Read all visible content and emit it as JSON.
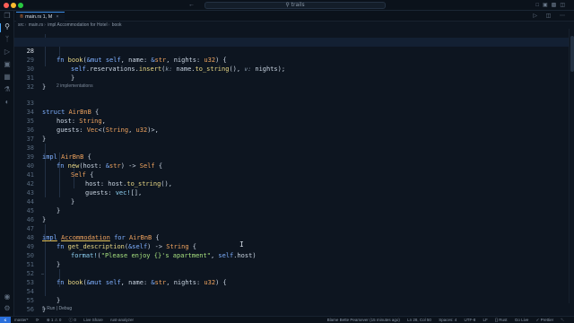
{
  "window": {
    "title": "trails",
    "nav_arrows": "← →"
  },
  "tab": {
    "icon": "®",
    "label": "main.rs 1, M",
    "close": "×"
  },
  "breadcrumb": [
    "src",
    "main.rs",
    "impl Accommodation for Hotel",
    "book"
  ],
  "codelens": {
    "implementations": "2 implementations"
  },
  "run_lens": "▷ Run | Debug",
  "status": {
    "remote": "≤",
    "branch": "master*",
    "sync": "⟳",
    "problems": "⊗ 1 ⚠ 0",
    "warnings": "ⓘ 0",
    "live_share": "Live Share",
    "analyzer": "rust-analyzer",
    "blame": "Blame Bette Pearsever (15 minutes ago)",
    "position": "Ln 28, Col 50",
    "spaces": "Spaces: 4",
    "encoding": "UTF-8",
    "eol": "LF",
    "language": "{} Rust",
    "golive": "Go Live",
    "prettier": "✓ Prettier",
    "bell": "␇"
  },
  "lines": [
    {
      "n": "27",
      "text": ""
    },
    {
      "n": "28",
      "text": "fn book(&mut self, name: &str, nights: u32) {"
    },
    {
      "n": "29",
      "text": "self.reservations.insert(k: name.to_string(), v: nights);"
    },
    {
      "n": "30",
      "text": "}"
    },
    {
      "n": "31",
      "text": "}"
    },
    {
      "n": "32",
      "text": ""
    },
    {
      "n": "33",
      "text": "struct AirBnB {"
    },
    {
      "n": "34",
      "text": "host: String,"
    },
    {
      "n": "35",
      "text": "guests: Vec<(String, u32)>,"
    },
    {
      "n": "36",
      "text": "}"
    },
    {
      "n": "37",
      "text": ""
    },
    {
      "n": "38",
      "text": "impl AirBnB {"
    },
    {
      "n": "39",
      "text": "fn new(host: &str) -> Self {"
    },
    {
      "n": "40",
      "text": "Self {"
    },
    {
      "n": "41",
      "text": "host: host.to_string(),"
    },
    {
      "n": "42",
      "text": "guests: vec![],"
    },
    {
      "n": "43",
      "text": "}"
    },
    {
      "n": "44",
      "text": "}"
    },
    {
      "n": "45",
      "text": "}"
    },
    {
      "n": "46",
      "text": ""
    },
    {
      "n": "47",
      "text": "impl Accommodation for AirBnB {"
    },
    {
      "n": "48",
      "text": "fn get_description(&self) -> String {"
    },
    {
      "n": "49",
      "text": "format!(\"Please enjoy {}'s apartment\", self.host)"
    },
    {
      "n": "50",
      "text": "}"
    },
    {
      "n": "51",
      "text": ""
    },
    {
      "n": "52",
      "text": "fn book(&mut self, name: &str, nights: u32) {"
    },
    {
      "n": "53",
      "text": ""
    },
    {
      "n": "54",
      "text": "}"
    },
    {
      "n": "55",
      "text": "}"
    },
    {
      "n": "56",
      "text": ""
    }
  ]
}
